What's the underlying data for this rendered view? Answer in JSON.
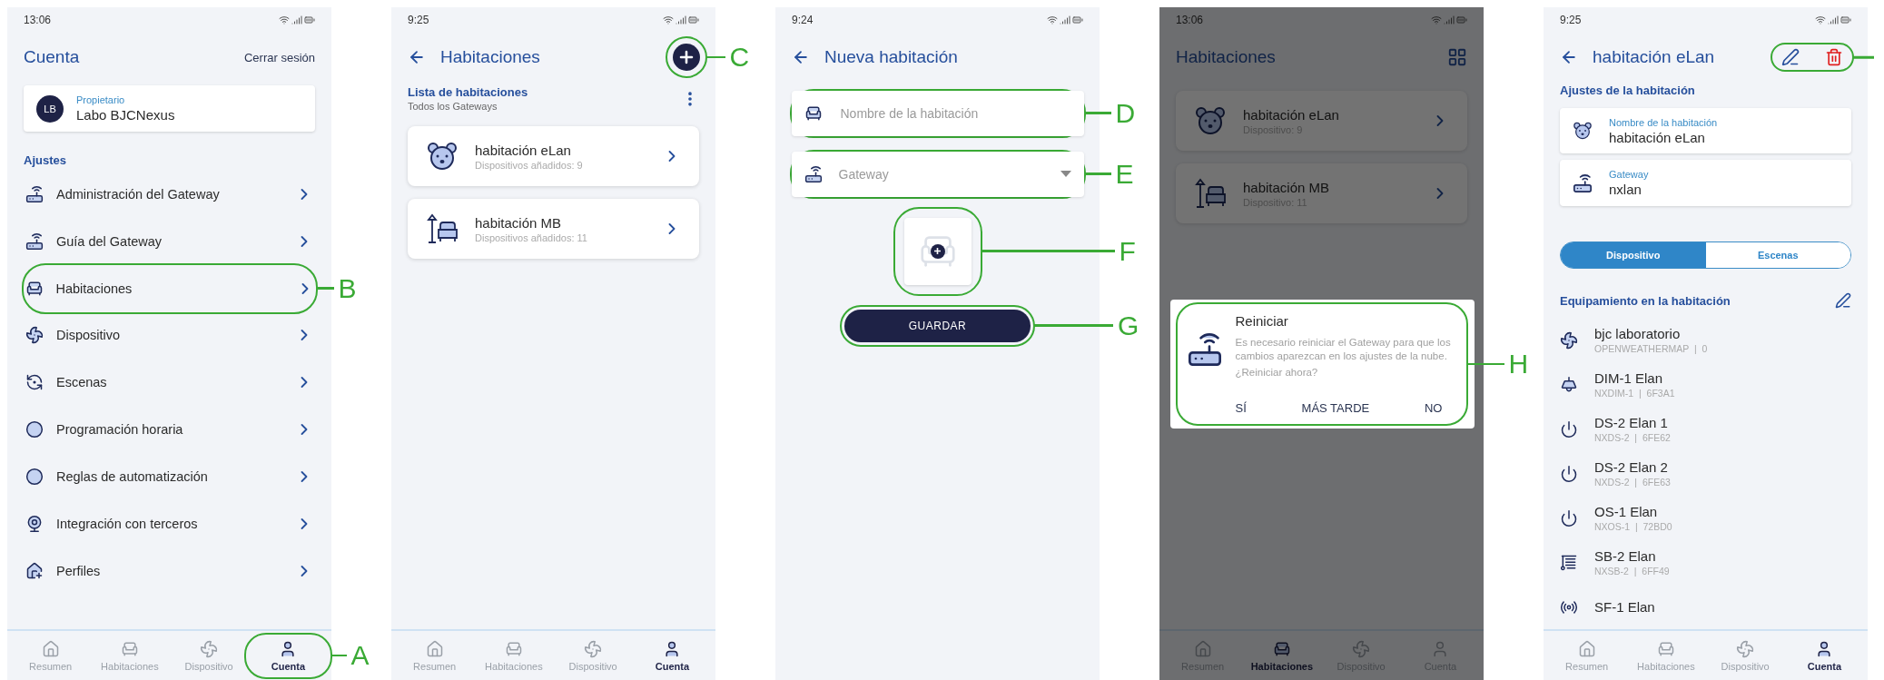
{
  "screens": [
    {
      "kind": "account",
      "time": "13:06",
      "title": "Cuenta",
      "action": "Cerrar sesión",
      "owner": {
        "initials": "LB",
        "role": "Propietario",
        "name": "Labo BJCNexus"
      },
      "section": "Ajustes",
      "menu": [
        {
          "label": "Administración del Gateway"
        },
        {
          "label": "Guía del Gateway"
        },
        {
          "label": "Habitaciones",
          "callout": "B"
        },
        {
          "label": "Dispositivo"
        },
        {
          "label": "Escenas"
        },
        {
          "label": "Programación horaria"
        },
        {
          "label": "Reglas de automatización"
        },
        {
          "label": "Integración con terceros"
        },
        {
          "label": "Perfiles"
        }
      ],
      "nav": [
        {
          "label": "Resumen",
          "selected": false
        },
        {
          "label": "Habitaciones",
          "selected": false
        },
        {
          "label": "Dispositivo",
          "selected": false
        },
        {
          "label": "Cuenta",
          "selected": true,
          "callout": "A"
        }
      ]
    },
    {
      "kind": "room-list",
      "time": "9:25",
      "title": "Habitaciones",
      "add_callout": "C",
      "list_title": "Lista de habitaciones",
      "list_subtitle": "Todos los Gateways",
      "rooms": [
        {
          "name": "habitación eLan",
          "meta": "Dispositivos añadidos: 9"
        },
        {
          "name": "habitación MB",
          "meta": "Dispositivos añadidos: 11"
        }
      ],
      "nav": [
        {
          "label": "Resumen",
          "selected": false
        },
        {
          "label": "Habitaciones",
          "selected": false
        },
        {
          "label": "Dispositivo",
          "selected": false
        },
        {
          "label": "Cuenta",
          "selected": true
        }
      ]
    },
    {
      "kind": "new-room",
      "time": "9:24",
      "title": "Nueva habitación",
      "fields": [
        {
          "kind": "text",
          "placeholder": "Nombre de la habitación",
          "callout": "D"
        },
        {
          "kind": "select",
          "placeholder": "Gateway",
          "callout": "E"
        }
      ],
      "image_callout": "F",
      "save": {
        "label": "GUARDAR",
        "callout": "G"
      }
    },
    {
      "kind": "rooms-dialog",
      "time": "13:06",
      "title": "Habitaciones",
      "rooms": [
        {
          "name": "habitación eLan",
          "meta": "Dispositivo: 9"
        },
        {
          "name": "habitación MB",
          "meta": "Dispositivo: 11"
        }
      ],
      "dialog": {
        "title": "Reiniciar",
        "body": "Es necesario reiniciar el Gateway para que los cambios aparezcan en los ajustes de la nube.",
        "question": "¿Reiniciar ahora?",
        "buttons": [
          "SÍ",
          "MÁS TARDE",
          "NO"
        ],
        "callout": "H"
      },
      "nav": [
        {
          "label": "Resumen",
          "selected": false
        },
        {
          "label": "Habitaciones",
          "selected": true
        },
        {
          "label": "Dispositivo",
          "selected": false
        },
        {
          "label": "Cuenta",
          "selected": false
        }
      ]
    },
    {
      "kind": "room-detail",
      "time": "9:25",
      "title": "habitación eLan",
      "actions_circled": true,
      "section": "Ajustes de la habitación",
      "fields": [
        {
          "label": "Nombre de la habitación",
          "value": "habitación eLan"
        },
        {
          "label": "Gateway",
          "value": "nxlan"
        }
      ],
      "tabs": [
        {
          "label": "Dispositivo",
          "selected": true
        },
        {
          "label": "Escenas",
          "selected": false
        }
      ],
      "list_title": "Equipamiento en la habitación",
      "devices": [
        {
          "name": "bjc laboratorio",
          "meta": "OPENWEATHERMAP  |  0"
        },
        {
          "name": "DIM-1 Elan",
          "meta": "NXDIM-1  |  6F3A1"
        },
        {
          "name": "DS-2 Elan 1",
          "meta": "NXDS-2  |  6FE62"
        },
        {
          "name": "DS-2 Elan 2",
          "meta": "NXDS-2  |  6FE63"
        },
        {
          "name": "OS-1 Elan",
          "meta": "NXOS-1  |  72BD0"
        },
        {
          "name": "SB-2 Elan",
          "meta": "NXSB-2  |  6FF49"
        },
        {
          "name": "SF-1 Elan"
        }
      ],
      "nav": [
        {
          "label": "Resumen",
          "selected": false
        },
        {
          "label": "Habitaciones",
          "selected": false
        },
        {
          "label": "Dispositivo",
          "selected": false
        },
        {
          "label": "Cuenta",
          "selected": true
        }
      ]
    }
  ]
}
